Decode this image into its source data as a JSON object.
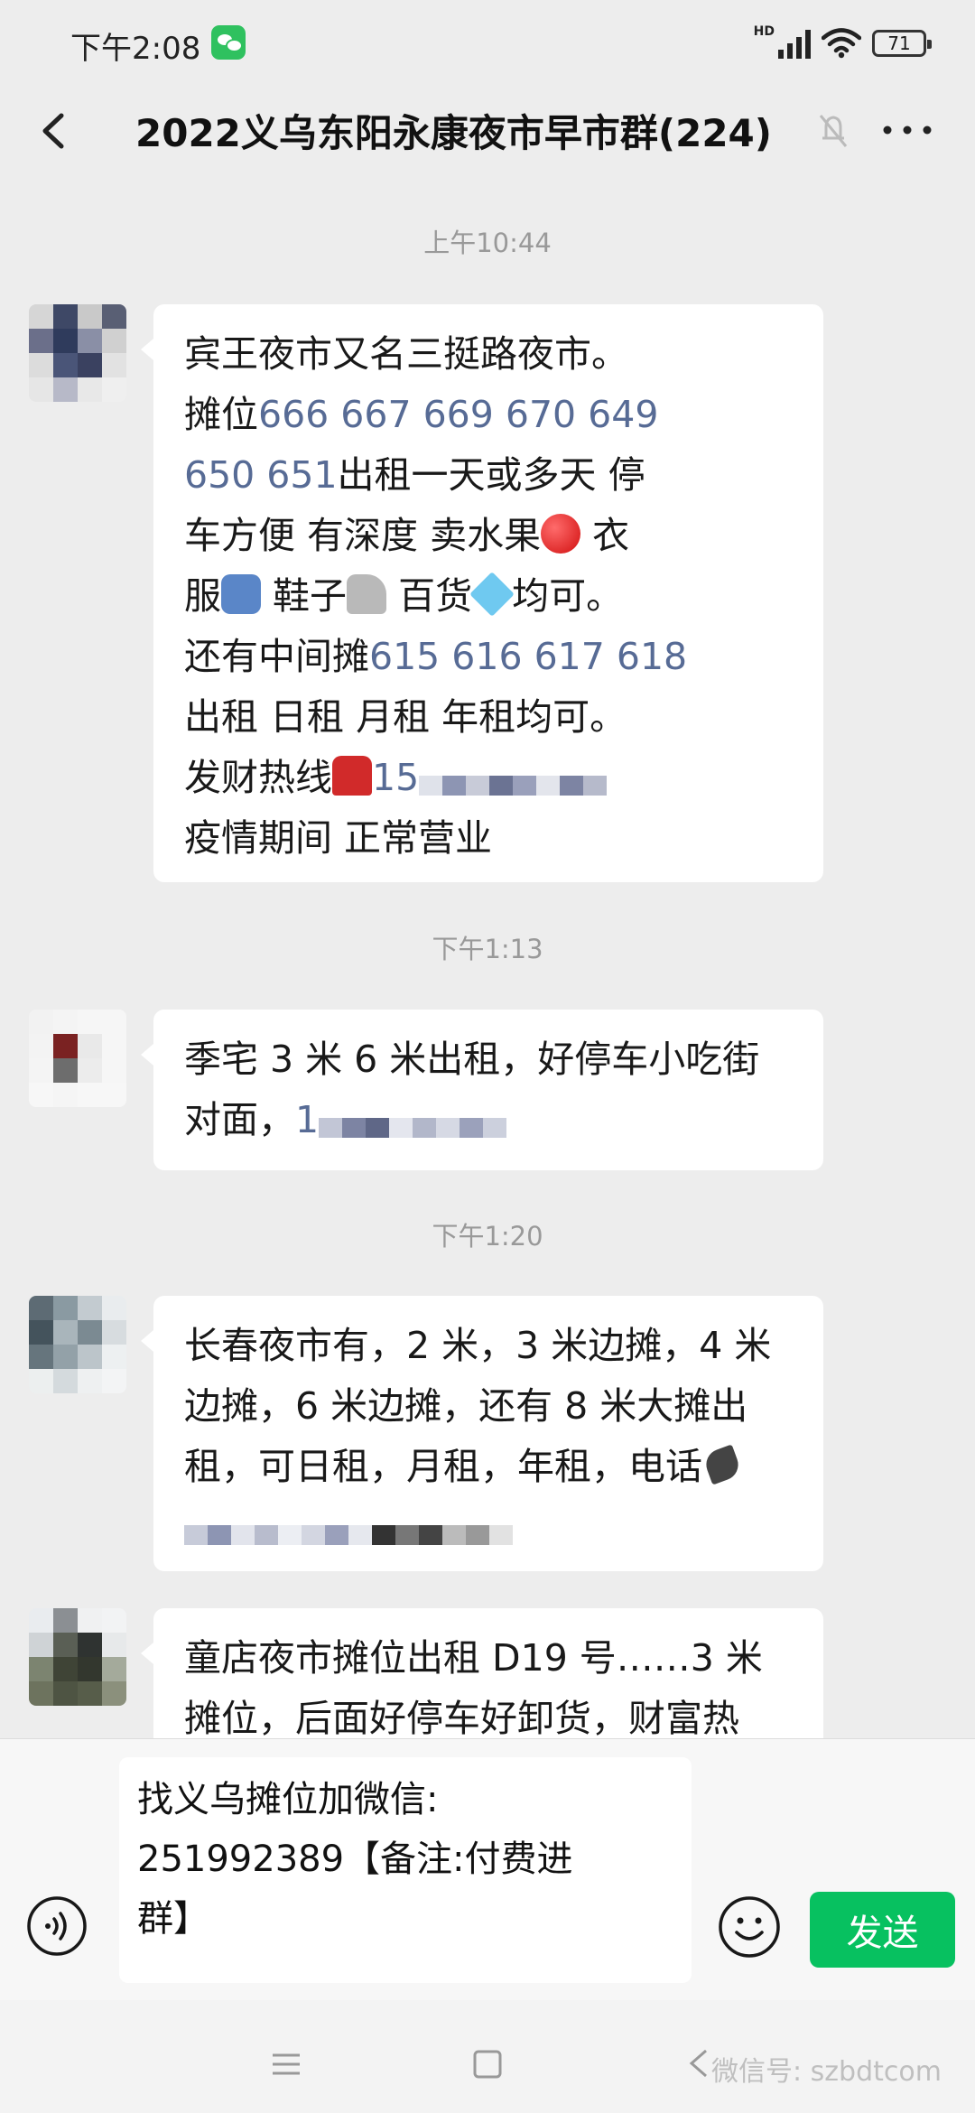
{
  "status_bar": {
    "time": "下午2:08",
    "network": "HD",
    "battery": "71"
  },
  "header": {
    "title": "2022义乌东阳永康夜市早市群(224)"
  },
  "messages": [
    {
      "timestamp": "上午10:44",
      "lines": [
        [
          "宾王夜市又名三挺路夜市。"
        ],
        [
          "摊位",
          "666 667 669 670 649"
        ],
        [
          "650 651",
          "出租一天或多天 停"
        ],
        [
          "车方便 有深度 卖水果",
          "衣"
        ],
        [
          "服",
          "鞋子",
          "百货",
          "均可。"
        ],
        [
          "还有中间摊",
          "615 616 617 618"
        ],
        [
          "出租 日租 月租 年租均可。"
        ],
        [
          "发财热线",
          "15"
        ],
        [
          "疫情期间 正常营业"
        ]
      ]
    },
    {
      "timestamp": "下午1:13",
      "lines": [
        [
          "季宅 3 米 6 米出租，好停车小吃街"
        ],
        [
          "对面，",
          "1"
        ]
      ]
    },
    {
      "timestamp": "下午1:20",
      "lines": [
        [
          "长春夜市有，2 米，3 米边摊，4 米"
        ],
        [
          "边摊，6 米边摊，还有 8 米大摊出"
        ],
        [
          "租，可日租，月租，年租，电话"
        ]
      ]
    },
    {
      "timestamp": "",
      "lines": [
        [
          "童店夜市摊位出租 D19 号……3 米"
        ],
        [
          "摊位，后面好停车好卸货，财富热"
        ]
      ]
    }
  ],
  "input": {
    "draft_lines": [
      "找义乌摊位加微信:",
      "251992389【备注:付费进",
      "群】"
    ],
    "send_label": "发送"
  },
  "watermark": "微信号: szbdtcom",
  "colors": {
    "accent": "#07c160",
    "link": "#576b95",
    "background": "#ededed"
  },
  "icons": [
    "wechat-icon",
    "back-arrow-icon",
    "mute-icon",
    "more-icon",
    "voice-icon",
    "emoji-icon",
    "menu-icon",
    "home-icon"
  ]
}
